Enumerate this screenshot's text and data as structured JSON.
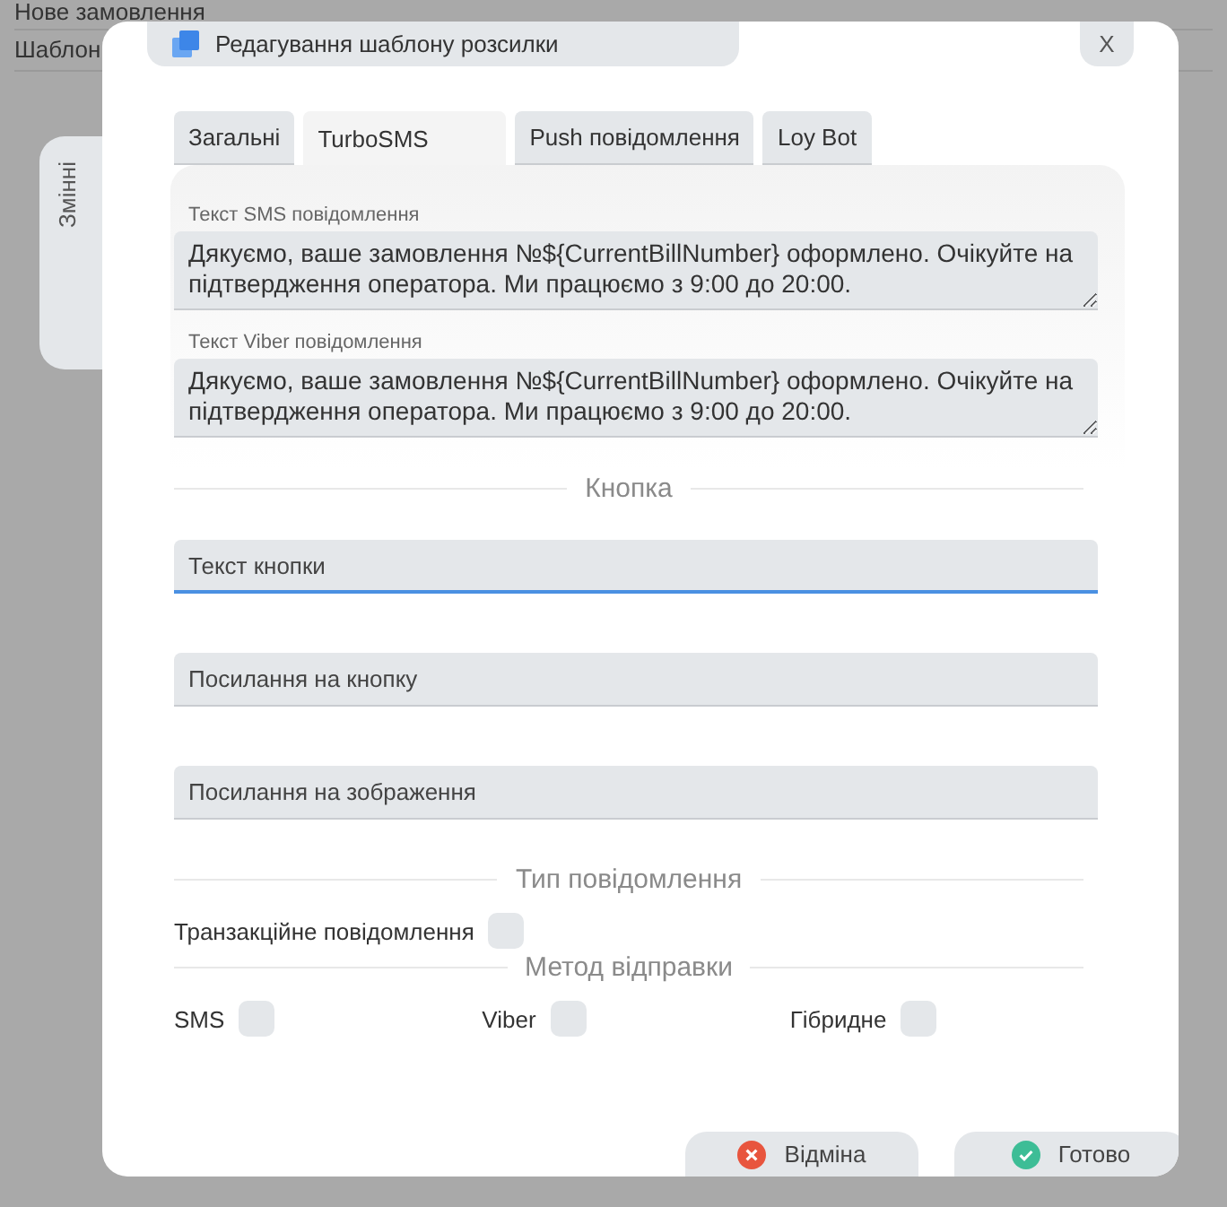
{
  "background": {
    "items": [
      "Нове замовлення",
      "Шаблон"
    ],
    "side_tab": "Змінні"
  },
  "dialog": {
    "title": "Редагування шаблону розсилки",
    "close": "X"
  },
  "tabs": [
    {
      "label": "Загальні",
      "selected": false
    },
    {
      "label": "TurboSMS",
      "selected": true
    },
    {
      "label": "Push повідомлення",
      "selected": false
    },
    {
      "label": "Loy Bot",
      "selected": false
    }
  ],
  "messages": [
    {
      "label": "Текст SMS повідомлення",
      "value": "Дякуємо, ваше замовлення №${CurrentBillNumber} оформлено. Очікуйте на підтвердження оператора. Ми працюємо з 9:00 до 20:00."
    },
    {
      "label": "Текст Viber повідомлення",
      "value": "Дякуємо, ваше замовлення №${CurrentBillNumber} оформлено. Очікуйте на підтвердження оператора. Ми працюємо з 9:00 до 20:00."
    }
  ],
  "button_section": {
    "heading": "Кнопка",
    "fields": [
      {
        "placeholder": "Текст кнопки",
        "focused": true
      },
      {
        "placeholder": "Посилання на кнопку",
        "focused": false
      },
      {
        "placeholder": "Посилання на зображення",
        "focused": false
      }
    ]
  },
  "message_type": {
    "heading": "Тип повідомлення",
    "options": [
      {
        "label": "Транзакційне повідомлення",
        "checked": false
      }
    ]
  },
  "send_method": {
    "heading": "Метод відправки",
    "options": [
      {
        "label": "SMS",
        "checked": false
      },
      {
        "label": "Viber",
        "checked": false
      },
      {
        "label": "Гібридне",
        "checked": false
      }
    ]
  },
  "footer": [
    {
      "kind": "cancel",
      "label": "Відміна"
    },
    {
      "kind": "done",
      "label": "Готово"
    }
  ]
}
